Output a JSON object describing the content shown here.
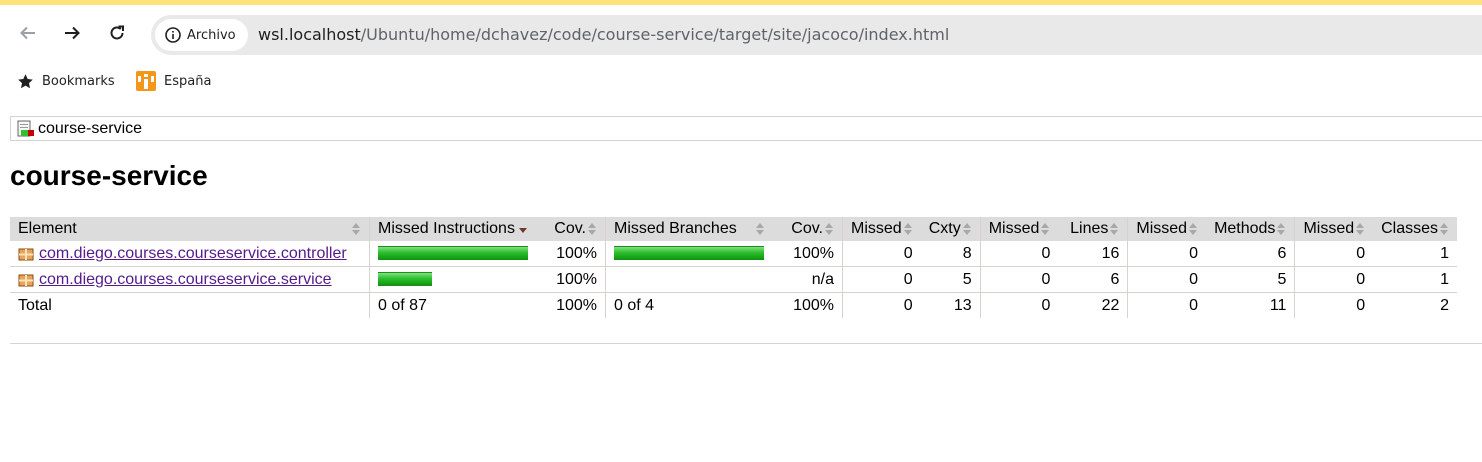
{
  "browser": {
    "chip_label": "Archivo",
    "url_host": "wsl.localhost",
    "url_path": "/Ubuntu/home/dchavez/code/course-service/target/site/jacoco/index.html",
    "icons": [
      "back-arrow-icon",
      "forward-arrow-icon",
      "reload-icon",
      "info-icon"
    ]
  },
  "bookmarks": [
    {
      "label": "Bookmarks",
      "icon": "star-icon"
    },
    {
      "label": "España",
      "icon": "favicon-icon"
    }
  ],
  "breadcrumb": {
    "label": "course-service",
    "icon": "report-icon"
  },
  "page_title": "course-service",
  "table": {
    "headers": {
      "element": "Element",
      "missed_instructions": "Missed Instructions",
      "cov1": "Cov.",
      "missed_branches": "Missed Branches",
      "cov2": "Cov.",
      "missed_cxty": "Missed",
      "cxty": "Cxty",
      "missed_lines": "Missed",
      "lines": "Lines",
      "missed_methods": "Missed",
      "methods": "Methods",
      "missed_classes": "Missed",
      "classes": "Classes"
    },
    "rows": [
      {
        "name": "com.diego.courses.courseservice.controller",
        "instr_bar_fraction": 1.0,
        "instr_cov": "100%",
        "branch_bar_fraction": 1.0,
        "branch_cov": "100%",
        "missed_cxty": "0",
        "cxty": "8",
        "missed_lines": "0",
        "lines": "16",
        "missed_methods": "0",
        "methods": "6",
        "missed_classes": "0",
        "classes": "1"
      },
      {
        "name": "com.diego.courses.courseservice.service",
        "instr_bar_fraction": 0.36,
        "instr_cov": "100%",
        "branch_bar_fraction": 0,
        "branch_cov": "n/a",
        "missed_cxty": "0",
        "cxty": "5",
        "missed_lines": "0",
        "lines": "6",
        "missed_methods": "0",
        "methods": "5",
        "missed_classes": "0",
        "classes": "1"
      }
    ],
    "total": {
      "label": "Total",
      "instructions": "0 of 87",
      "instr_cov": "100%",
      "branches": "0 of 4",
      "branch_cov": "100%",
      "missed_cxty": "0",
      "cxty": "13",
      "missed_lines": "0",
      "lines": "22",
      "missed_methods": "0",
      "methods": "11",
      "missed_classes": "0",
      "classes": "2"
    }
  },
  "colors": {
    "coverage_bar": "#2fbf2f",
    "link": "#551a8b",
    "header_bg": "#dcdcdc",
    "top_strip": "#fce47a"
  }
}
